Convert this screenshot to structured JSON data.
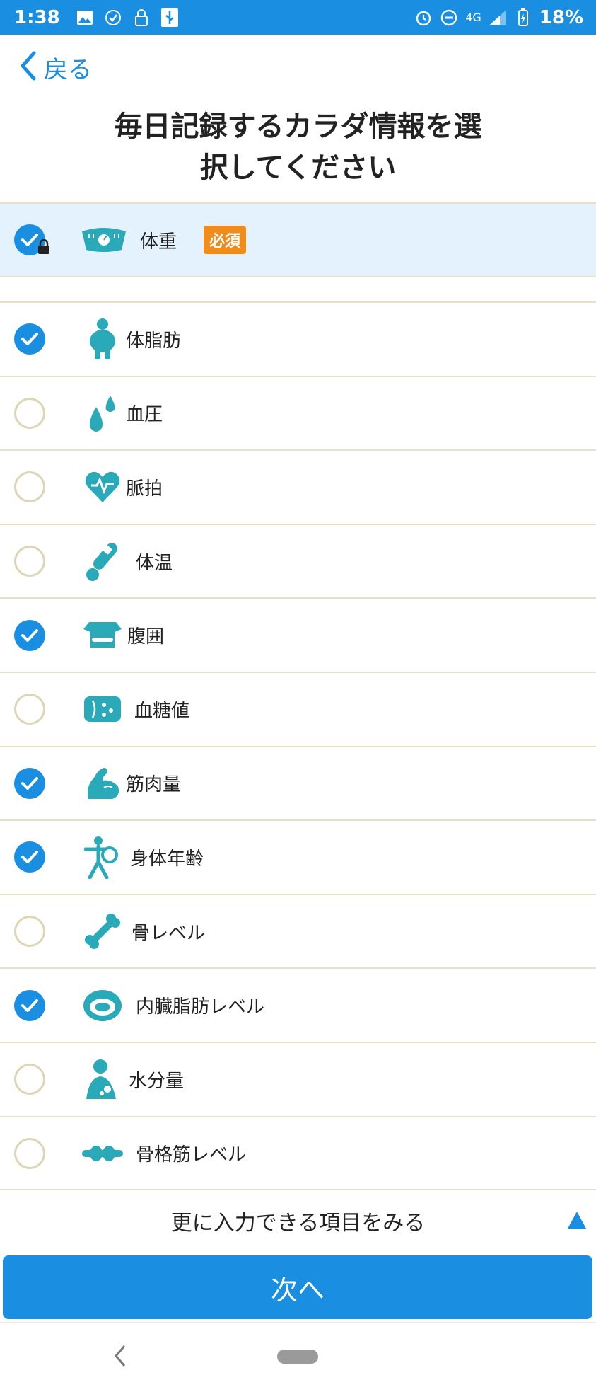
{
  "status_bar": {
    "time": "1:38",
    "network": "4G",
    "battery": "18%"
  },
  "header": {
    "back_label": "戻る",
    "title_line1": "毎日記録するカラダ情報を選",
    "title_line2": "択してください"
  },
  "required_item": {
    "label": "体重",
    "badge": "必須",
    "checked": true,
    "locked": true,
    "icon": "scale-icon"
  },
  "items": [
    {
      "label": "体脂肪",
      "checked": true,
      "icon": "body-fat-icon"
    },
    {
      "label": "血圧",
      "checked": false,
      "icon": "blood-pressure-icon"
    },
    {
      "label": "脈拍",
      "checked": false,
      "icon": "pulse-heart-icon"
    },
    {
      "label": "体温",
      "checked": false,
      "icon": "thermometer-icon"
    },
    {
      "label": "腹囲",
      "checked": true,
      "icon": "waist-icon"
    },
    {
      "label": "血糖値",
      "checked": false,
      "icon": "blood-sugar-icon"
    },
    {
      "label": "筋肉量",
      "checked": true,
      "icon": "muscle-icon"
    },
    {
      "label": "身体年齢",
      "checked": true,
      "icon": "body-age-icon"
    },
    {
      "label": "骨レベル",
      "checked": false,
      "icon": "bone-icon"
    },
    {
      "label": "内臓脂肪レベル",
      "checked": true,
      "icon": "visceral-fat-icon"
    },
    {
      "label": "水分量",
      "checked": false,
      "icon": "water-icon"
    },
    {
      "label": "骨格筋レベル",
      "checked": false,
      "icon": "skeletal-muscle-icon"
    }
  ],
  "more_label": "更に入力できる項目をみる",
  "next_button": "次へ",
  "colors": {
    "accent": "#1a8ee0",
    "icon_teal": "#2aa9b8",
    "badge_orange": "#f08c1c",
    "highlight_bg": "#e3f2fc"
  }
}
